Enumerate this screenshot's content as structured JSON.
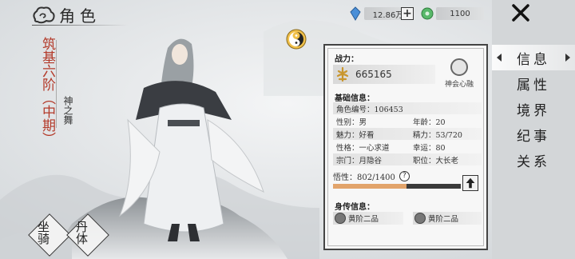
{
  "header": {
    "title": "角色"
  },
  "currency": {
    "silver": "12.86万",
    "jade": "1100",
    "add_label": "+"
  },
  "sidebar": {
    "items": [
      {
        "label": "信息",
        "active": true
      },
      {
        "label": "属性",
        "active": false
      },
      {
        "label": "境界",
        "active": false
      },
      {
        "label": "纪事",
        "active": false
      },
      {
        "label": "关系",
        "active": false
      }
    ]
  },
  "character": {
    "rank": "筑基六阶（中期）",
    "epithet": "神之舞"
  },
  "panel": {
    "power_label": "战力：",
    "power_value": "665165",
    "heart_caption": "神会心融",
    "basic_label": "基础信息：",
    "rows": [
      {
        "c1": "角色编号：106453",
        "c2": ""
      },
      {
        "c1": "性别：男",
        "c2": "年龄：20"
      },
      {
        "c1": "魅力：好看",
        "c2": "精力：53/720"
      },
      {
        "c1": "性格：一心求道",
        "c2": "幸运：80"
      },
      {
        "c1": "宗门：月隐谷",
        "c2": "职位：大长老"
      }
    ],
    "comprehension_label": "悟性：802/1400",
    "comprehension_value": 802,
    "comprehension_max": 1400,
    "skill_label": "身传信息：",
    "skills": [
      "黄阶二品",
      "黄阶二品"
    ]
  },
  "actions": {
    "mount": "坐骑",
    "elixir": "丹体"
  },
  "colors": {
    "rank_red": "#b33a2a",
    "bar_fill": "#e2a46b"
  }
}
